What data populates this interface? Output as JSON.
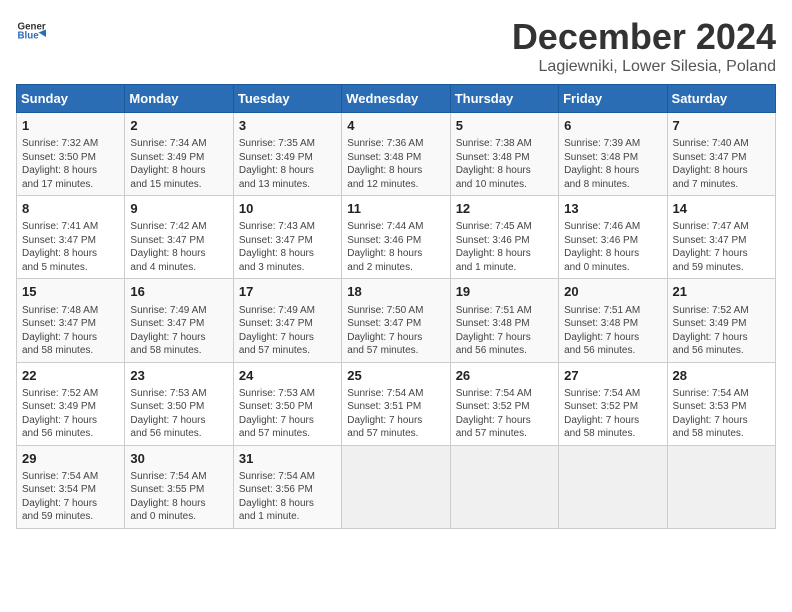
{
  "header": {
    "logo_general": "General",
    "logo_blue": "Blue",
    "month": "December 2024",
    "location": "Lagiewniki, Lower Silesia, Poland"
  },
  "weekdays": [
    "Sunday",
    "Monday",
    "Tuesday",
    "Wednesday",
    "Thursday",
    "Friday",
    "Saturday"
  ],
  "weeks": [
    [
      {
        "day": "1",
        "lines": [
          "Sunrise: 7:32 AM",
          "Sunset: 3:50 PM",
          "Daylight: 8 hours",
          "and 17 minutes."
        ]
      },
      {
        "day": "2",
        "lines": [
          "Sunrise: 7:34 AM",
          "Sunset: 3:49 PM",
          "Daylight: 8 hours",
          "and 15 minutes."
        ]
      },
      {
        "day": "3",
        "lines": [
          "Sunrise: 7:35 AM",
          "Sunset: 3:49 PM",
          "Daylight: 8 hours",
          "and 13 minutes."
        ]
      },
      {
        "day": "4",
        "lines": [
          "Sunrise: 7:36 AM",
          "Sunset: 3:48 PM",
          "Daylight: 8 hours",
          "and 12 minutes."
        ]
      },
      {
        "day": "5",
        "lines": [
          "Sunrise: 7:38 AM",
          "Sunset: 3:48 PM",
          "Daylight: 8 hours",
          "and 10 minutes."
        ]
      },
      {
        "day": "6",
        "lines": [
          "Sunrise: 7:39 AM",
          "Sunset: 3:48 PM",
          "Daylight: 8 hours",
          "and 8 minutes."
        ]
      },
      {
        "day": "7",
        "lines": [
          "Sunrise: 7:40 AM",
          "Sunset: 3:47 PM",
          "Daylight: 8 hours",
          "and 7 minutes."
        ]
      }
    ],
    [
      {
        "day": "8",
        "lines": [
          "Sunrise: 7:41 AM",
          "Sunset: 3:47 PM",
          "Daylight: 8 hours",
          "and 5 minutes."
        ]
      },
      {
        "day": "9",
        "lines": [
          "Sunrise: 7:42 AM",
          "Sunset: 3:47 PM",
          "Daylight: 8 hours",
          "and 4 minutes."
        ]
      },
      {
        "day": "10",
        "lines": [
          "Sunrise: 7:43 AM",
          "Sunset: 3:47 PM",
          "Daylight: 8 hours",
          "and 3 minutes."
        ]
      },
      {
        "day": "11",
        "lines": [
          "Sunrise: 7:44 AM",
          "Sunset: 3:46 PM",
          "Daylight: 8 hours",
          "and 2 minutes."
        ]
      },
      {
        "day": "12",
        "lines": [
          "Sunrise: 7:45 AM",
          "Sunset: 3:46 PM",
          "Daylight: 8 hours",
          "and 1 minute."
        ]
      },
      {
        "day": "13",
        "lines": [
          "Sunrise: 7:46 AM",
          "Sunset: 3:46 PM",
          "Daylight: 8 hours",
          "and 0 minutes."
        ]
      },
      {
        "day": "14",
        "lines": [
          "Sunrise: 7:47 AM",
          "Sunset: 3:47 PM",
          "Daylight: 7 hours",
          "and 59 minutes."
        ]
      }
    ],
    [
      {
        "day": "15",
        "lines": [
          "Sunrise: 7:48 AM",
          "Sunset: 3:47 PM",
          "Daylight: 7 hours",
          "and 58 minutes."
        ]
      },
      {
        "day": "16",
        "lines": [
          "Sunrise: 7:49 AM",
          "Sunset: 3:47 PM",
          "Daylight: 7 hours",
          "and 58 minutes."
        ]
      },
      {
        "day": "17",
        "lines": [
          "Sunrise: 7:49 AM",
          "Sunset: 3:47 PM",
          "Daylight: 7 hours",
          "and 57 minutes."
        ]
      },
      {
        "day": "18",
        "lines": [
          "Sunrise: 7:50 AM",
          "Sunset: 3:47 PM",
          "Daylight: 7 hours",
          "and 57 minutes."
        ]
      },
      {
        "day": "19",
        "lines": [
          "Sunrise: 7:51 AM",
          "Sunset: 3:48 PM",
          "Daylight: 7 hours",
          "and 56 minutes."
        ]
      },
      {
        "day": "20",
        "lines": [
          "Sunrise: 7:51 AM",
          "Sunset: 3:48 PM",
          "Daylight: 7 hours",
          "and 56 minutes."
        ]
      },
      {
        "day": "21",
        "lines": [
          "Sunrise: 7:52 AM",
          "Sunset: 3:49 PM",
          "Daylight: 7 hours",
          "and 56 minutes."
        ]
      }
    ],
    [
      {
        "day": "22",
        "lines": [
          "Sunrise: 7:52 AM",
          "Sunset: 3:49 PM",
          "Daylight: 7 hours",
          "and 56 minutes."
        ]
      },
      {
        "day": "23",
        "lines": [
          "Sunrise: 7:53 AM",
          "Sunset: 3:50 PM",
          "Daylight: 7 hours",
          "and 56 minutes."
        ]
      },
      {
        "day": "24",
        "lines": [
          "Sunrise: 7:53 AM",
          "Sunset: 3:50 PM",
          "Daylight: 7 hours",
          "and 57 minutes."
        ]
      },
      {
        "day": "25",
        "lines": [
          "Sunrise: 7:54 AM",
          "Sunset: 3:51 PM",
          "Daylight: 7 hours",
          "and 57 minutes."
        ]
      },
      {
        "day": "26",
        "lines": [
          "Sunrise: 7:54 AM",
          "Sunset: 3:52 PM",
          "Daylight: 7 hours",
          "and 57 minutes."
        ]
      },
      {
        "day": "27",
        "lines": [
          "Sunrise: 7:54 AM",
          "Sunset: 3:52 PM",
          "Daylight: 7 hours",
          "and 58 minutes."
        ]
      },
      {
        "day": "28",
        "lines": [
          "Sunrise: 7:54 AM",
          "Sunset: 3:53 PM",
          "Daylight: 7 hours",
          "and 58 minutes."
        ]
      }
    ],
    [
      {
        "day": "29",
        "lines": [
          "Sunrise: 7:54 AM",
          "Sunset: 3:54 PM",
          "Daylight: 7 hours",
          "and 59 minutes."
        ]
      },
      {
        "day": "30",
        "lines": [
          "Sunrise: 7:54 AM",
          "Sunset: 3:55 PM",
          "Daylight: 8 hours",
          "and 0 minutes."
        ]
      },
      {
        "day": "31",
        "lines": [
          "Sunrise: 7:54 AM",
          "Sunset: 3:56 PM",
          "Daylight: 8 hours",
          "and 1 minute."
        ]
      },
      null,
      null,
      null,
      null
    ]
  ]
}
